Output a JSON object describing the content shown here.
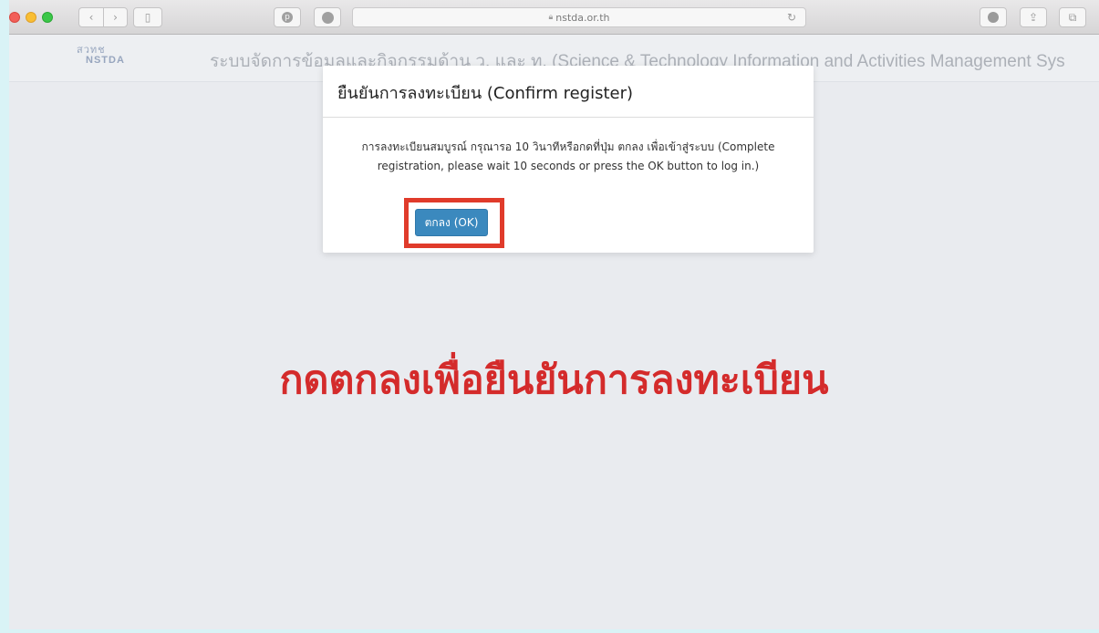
{
  "browser": {
    "url": "nstda.or.th",
    "icons": [
      "sidebar-icon",
      "pinterest-icon",
      "adblock-icon",
      "download-icon",
      "share-icon",
      "tabs-icon",
      "reload-icon",
      "lock-icon"
    ]
  },
  "site": {
    "logo_line1": "สวทช",
    "logo_line2": "NSTDA",
    "title": "ระบบจัดการข้อมูลและกิจกรรมด้าน ว. และ ท. (Science & Technology Information and Activities Management Sys"
  },
  "modal": {
    "title": "ยืนยันการลงทะเบียน (Confirm register)",
    "message_line1": "การลงทะเบียนสมบูรณ์ กรุณารอ 10 วินาทีหรือกดที่ปุ่ม ตกลง เพื่อเข้าสู่ระบบ (Complete",
    "message_line2": "registration, please wait 10 seconds or press the OK button to log in.)",
    "ok_label": "ตกลง (OK)"
  },
  "caption": "กดตกลงเพื่อยืนยันการลงทะเบียน",
  "colors": {
    "highlight": "#e03b2b",
    "caption": "#d42b2b",
    "ok_button": "#3b89be"
  }
}
